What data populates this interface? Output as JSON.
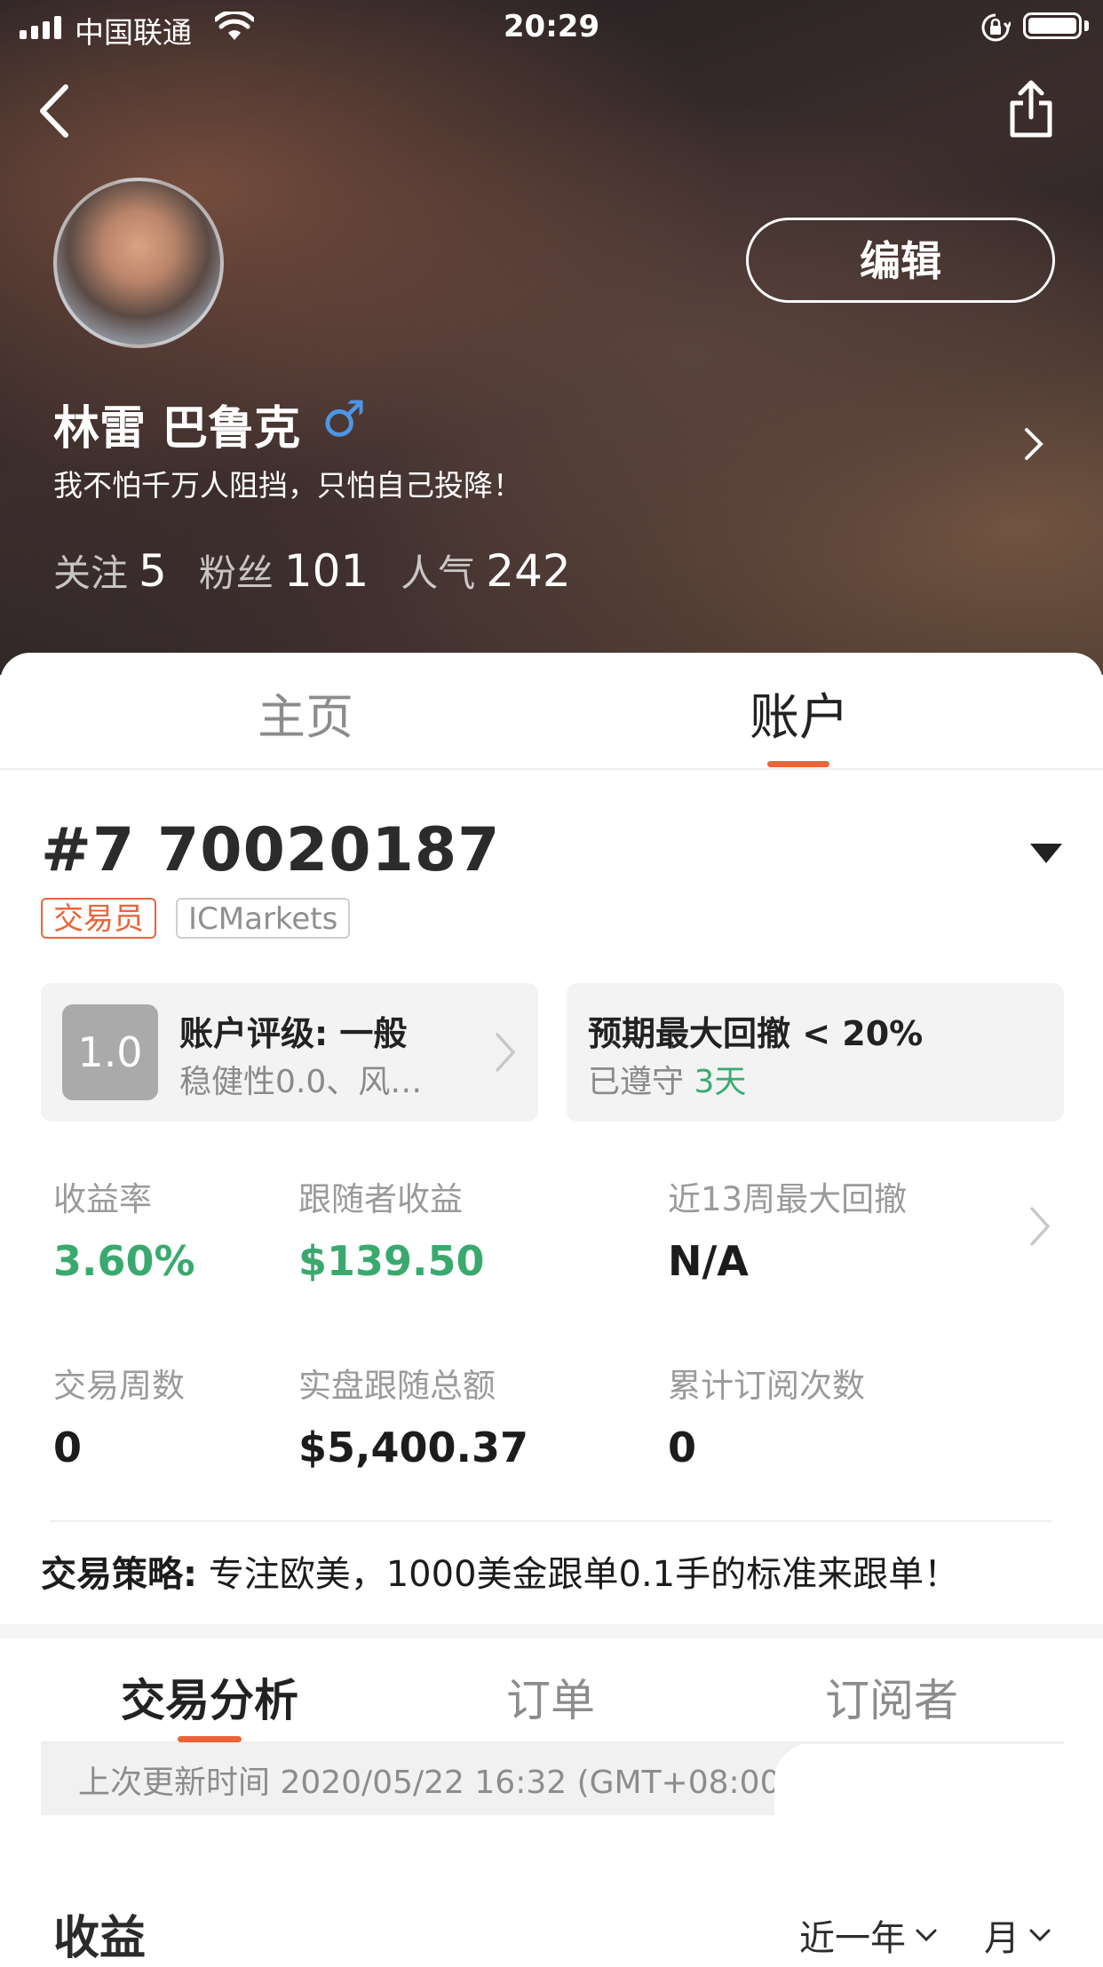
{
  "status_bar": {
    "carrier": "中国联通",
    "time": "20:29"
  },
  "header": {
    "edit_label": "编辑",
    "name": "林雷 巴鲁克",
    "gender_symbol": "♂",
    "bio": "我不怕千万人阻挡，只怕自己投降！",
    "stats": [
      {
        "label": "关注",
        "value": "5"
      },
      {
        "label": "粉丝",
        "value": "101"
      },
      {
        "label": "人气",
        "value": "242"
      }
    ]
  },
  "main_tabs": [
    {
      "label": "主页",
      "active": false
    },
    {
      "label": "账户",
      "active": true
    }
  ],
  "account": {
    "number": "#7 70020187",
    "tags": {
      "role": "交易员",
      "broker": "ICMarkets"
    },
    "rating": {
      "score": "1.0",
      "title": "账户评级: 一般",
      "detail": "稳健性0.0、风…"
    },
    "drawdown": {
      "title": "预期最大回撤 < 20%",
      "kept_label": "已遵守",
      "kept_days": "3天"
    },
    "metrics": [
      {
        "label": "收益率",
        "value": "3.60%",
        "color": "#3aa96e"
      },
      {
        "label": "跟随者收益",
        "value": "$139.50",
        "color": "#3aa96e"
      },
      {
        "label": "近13周最大回撤",
        "value": "N/A"
      },
      {
        "label": "交易周数",
        "value": "0"
      },
      {
        "label": "实盘跟随总额",
        "value": "$5,400.37"
      },
      {
        "label": "累计订阅次数",
        "value": "0"
      }
    ],
    "strategy_label": "交易策略:",
    "strategy_text": "专注欧美，1000美金跟单0.1手的标准来跟单！"
  },
  "sub_tabs": [
    {
      "label": "交易分析",
      "active": true
    },
    {
      "label": "订单",
      "active": false
    },
    {
      "label": "订阅者",
      "active": false
    }
  ],
  "update_text": "上次更新时间 2020/05/22 16:32 (GMT+08:00)",
  "revenue": {
    "title": "收益",
    "period_filter": "近一年",
    "granularity_filter": "月"
  },
  "colors": {
    "accent": "#e8653a",
    "positive": "#3aa96e",
    "gender": "#4d96e6"
  },
  "icons": [
    "back-icon",
    "share-icon",
    "chevron-right-icon",
    "caret-down-icon",
    "chevron-down-icon",
    "wifi-icon",
    "battery-icon",
    "rotation-lock-icon",
    "signal-icon"
  ]
}
